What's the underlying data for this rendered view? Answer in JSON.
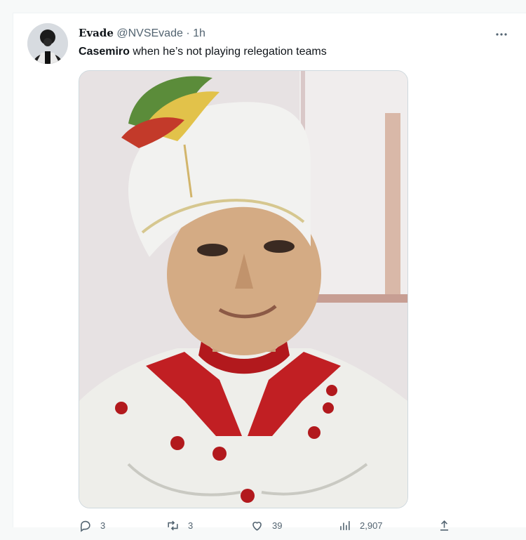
{
  "tweet": {
    "display_name": "Evade",
    "handle": "@NVSEvade",
    "separator": "·",
    "time": "1h",
    "text_bold": "Casemiro",
    "text_rest": " when he’s not playing relegation teams"
  },
  "actions": {
    "reply_count": "3",
    "retweet_count": "3",
    "like_count": "39",
    "views_count": "2,907"
  },
  "icons": {
    "more": "more-icon",
    "reply": "reply-icon",
    "retweet": "retweet-icon",
    "like": "heart-icon",
    "views": "views-icon",
    "share": "share-icon"
  },
  "colors": {
    "text_primary": "#0f1419",
    "text_secondary": "#536471",
    "border": "#cfd9de",
    "turban": "#f2f2f0",
    "collar_red": "#c11f23"
  }
}
